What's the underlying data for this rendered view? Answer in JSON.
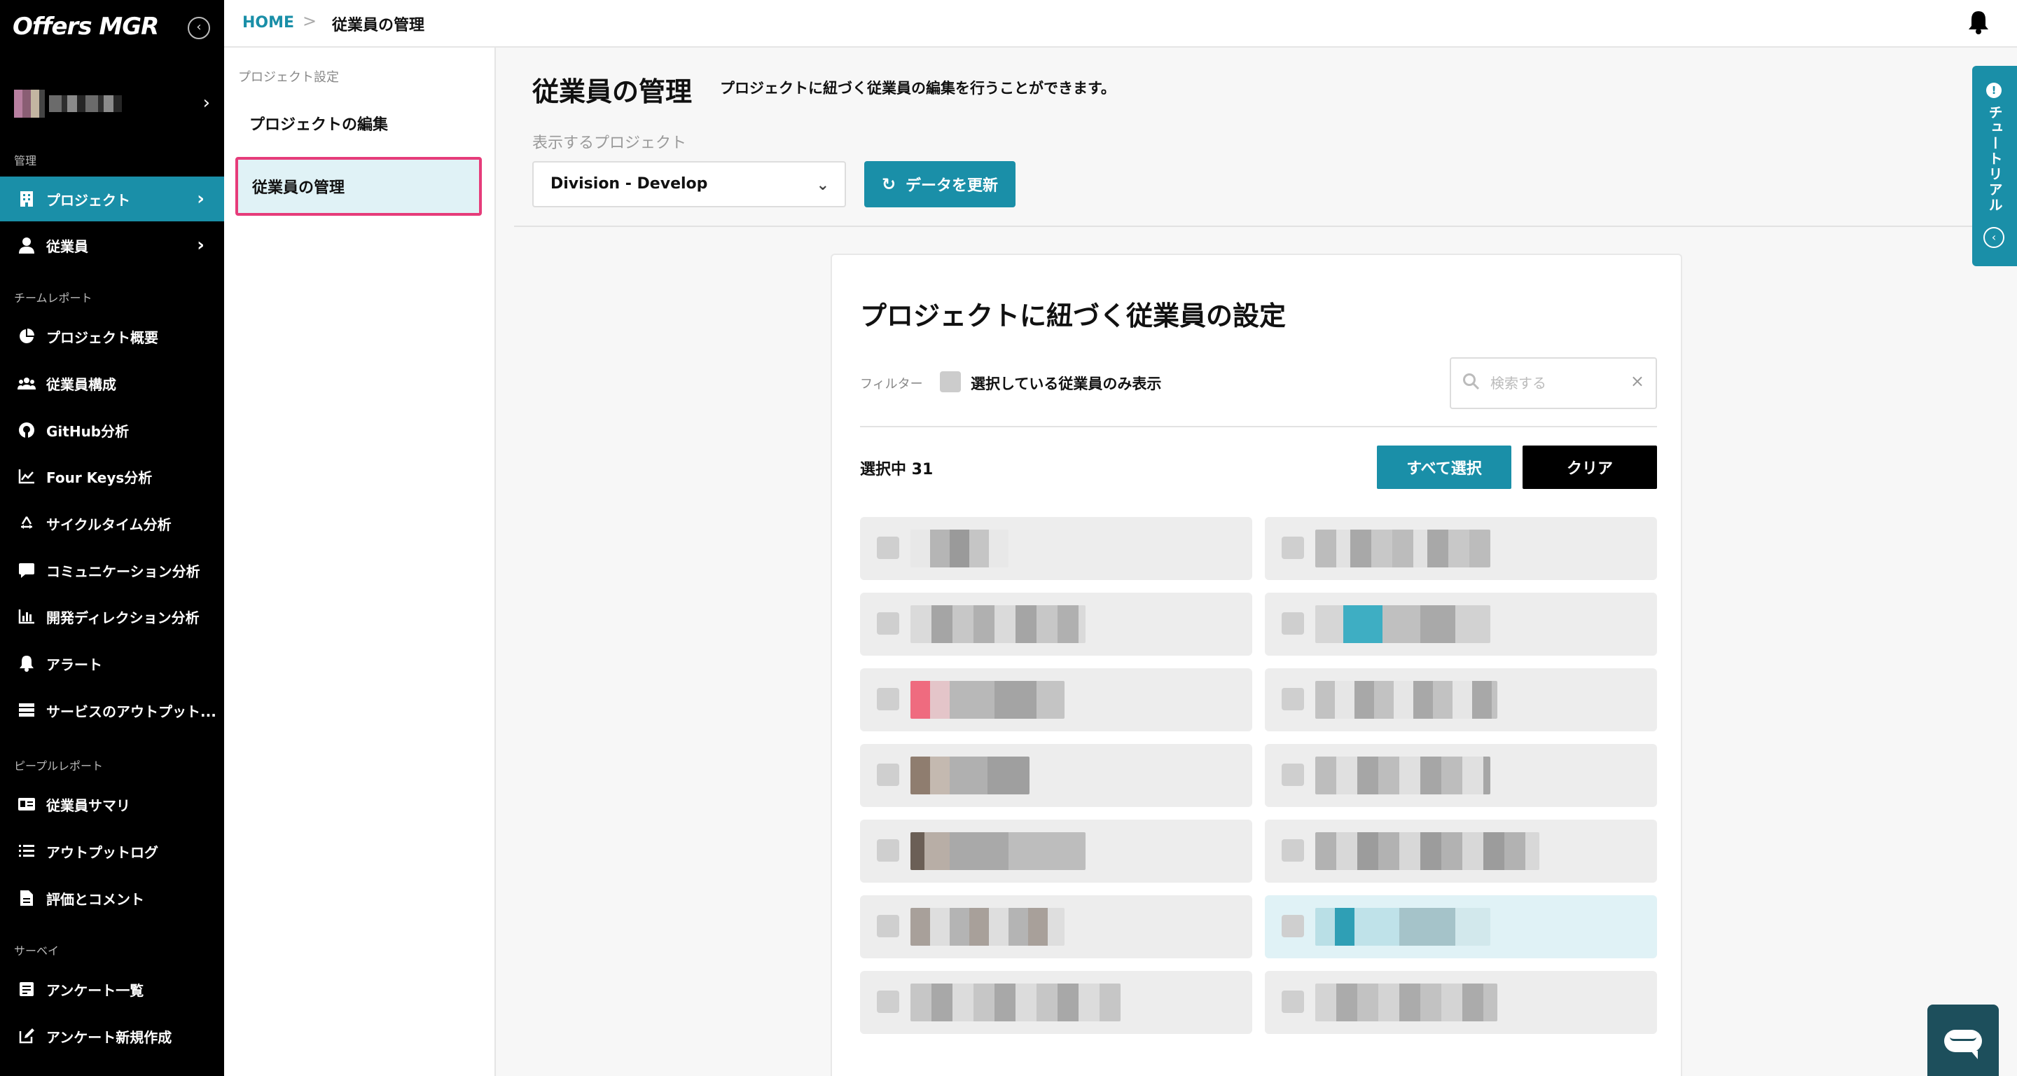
{
  "app": {
    "title": "Offers MGR"
  },
  "sidebar": {
    "sections": [
      {
        "label": "管理"
      },
      {
        "label": "チームレポート"
      },
      {
        "label": "ピープルレポート"
      },
      {
        "label": "サーベイ"
      }
    ],
    "items": [
      {
        "label": "プロジェクト",
        "icon": "building-icon",
        "active": true,
        "chevron": true
      },
      {
        "label": "従業員",
        "icon": "person-icon",
        "chevron": true
      },
      {
        "label": "プロジェクト概要",
        "icon": "pie-chart-icon"
      },
      {
        "label": "従業員構成",
        "icon": "group-icon"
      },
      {
        "label": "GitHub分析",
        "icon": "github-icon"
      },
      {
        "label": "Four Keys分析",
        "icon": "line-chart-icon"
      },
      {
        "label": "サイクルタイム分析",
        "icon": "recycle-icon"
      },
      {
        "label": "コミュニケーション分析",
        "icon": "chat-icon"
      },
      {
        "label": "開発ディレクション分析",
        "icon": "bar-chart-icon"
      },
      {
        "label": "アラート",
        "icon": "bell-icon"
      },
      {
        "label": "サービスのアウトプット...",
        "icon": "server-icon"
      },
      {
        "label": "従業員サマリ",
        "icon": "id-card-icon"
      },
      {
        "label": "アウトプットログ",
        "icon": "list-icon"
      },
      {
        "label": "評価とコメント",
        "icon": "document-icon"
      },
      {
        "label": "アンケート一覧",
        "icon": "survey-icon"
      },
      {
        "label": "アンケート新規作成",
        "icon": "edit-icon"
      }
    ]
  },
  "breadcrumb": {
    "home": "HOME",
    "separator": ">",
    "current": "従業員の管理"
  },
  "subnav": {
    "title": "プロジェクト設定",
    "items": [
      {
        "label": "プロジェクトの編集"
      },
      {
        "label": "従業員の管理",
        "active": true
      }
    ]
  },
  "main": {
    "title": "従業員の管理",
    "description": "プロジェクトに紐づく従業員の編集を行うことができます。",
    "project_label": "表示するプロジェクト",
    "project_selected": "Division - Develop",
    "refresh_label": "データを更新"
  },
  "tutorial": {
    "label": "チュートリアル"
  },
  "card": {
    "title": "プロジェクトに紐づく従業員の設定",
    "filter_label": "フィルター",
    "filter_option": "選択している従業員のみ表示",
    "search_placeholder": "検索する",
    "selected_count": "選択中 31",
    "select_all": "すべて選択",
    "clear": "クリア"
  },
  "colors": {
    "accent": "#1a8fa8",
    "highlight_border": "#e63c7a",
    "sidebar_bg": "#000000"
  }
}
